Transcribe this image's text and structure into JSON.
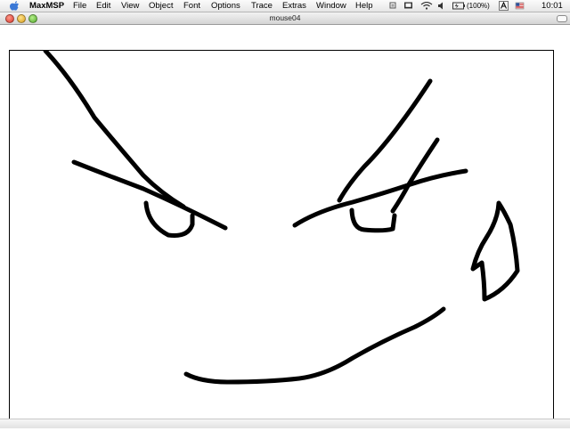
{
  "menubar": {
    "app_name": "MaxMSP",
    "menus": [
      "File",
      "Edit",
      "View",
      "Object",
      "Font",
      "Options",
      "Trace",
      "Extras",
      "Window",
      "Help"
    ],
    "battery_text": "(100%)",
    "clock": "10:01"
  },
  "window": {
    "title": "mouse04"
  },
  "drawing": {
    "stroke_color": "#000000",
    "description_icon": "brush-stroke"
  }
}
